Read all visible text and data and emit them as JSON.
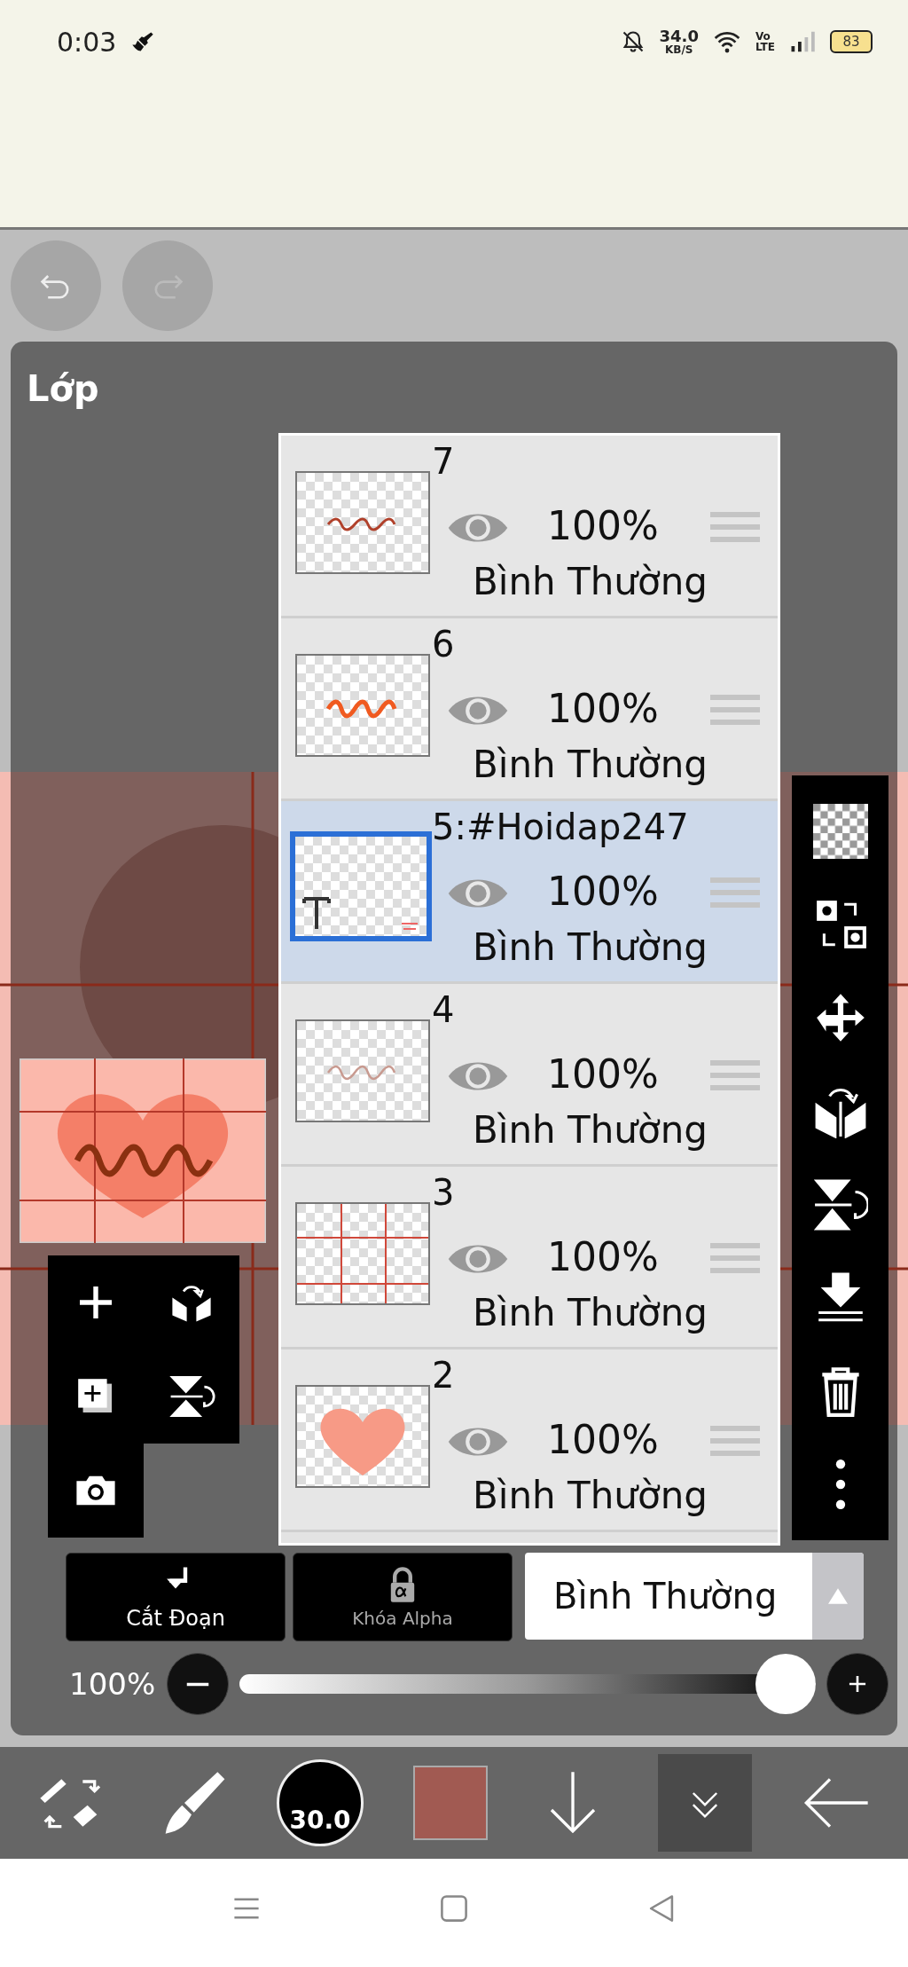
{
  "status_bar": {
    "time": "0:03",
    "speed": "34.0",
    "speed_unit": "KB/S",
    "volte_top": "Vo",
    "volte_bottom": "LTE",
    "battery": "83"
  },
  "panel": {
    "title": "Lớp"
  },
  "layers": [
    {
      "name": "7",
      "opacity": "100%",
      "blend": "Bình Thường",
      "selected": false,
      "visible": true,
      "kind": "script"
    },
    {
      "name": "6",
      "opacity": "100%",
      "blend": "Bình Thường",
      "selected": false,
      "visible": true,
      "kind": "script-bold"
    },
    {
      "name": "5:#Hoidap247",
      "opacity": "100%",
      "blend": "Bình Thường",
      "selected": true,
      "visible": true,
      "kind": "text"
    },
    {
      "name": "4",
      "opacity": "100%",
      "blend": "Bình Thường",
      "selected": false,
      "visible": true,
      "kind": "script-faint"
    },
    {
      "name": "3",
      "opacity": "100%",
      "blend": "Bình Thường",
      "selected": false,
      "visible": true,
      "kind": "grid"
    },
    {
      "name": "2",
      "opacity": "100%",
      "blend": "Bình Thường",
      "selected": false,
      "visible": true,
      "kind": "heart"
    }
  ],
  "actions": [
    {
      "label": "Cắt Đoạn",
      "kind": "clip",
      "disabled": false
    },
    {
      "label": "Khóa Alpha",
      "kind": "lock",
      "disabled": true
    }
  ],
  "blend_select": {
    "value": "Bình Thường"
  },
  "opacity": {
    "reading": "100%",
    "level": 1
  },
  "toolbar": {
    "brush_size": "30.0"
  }
}
